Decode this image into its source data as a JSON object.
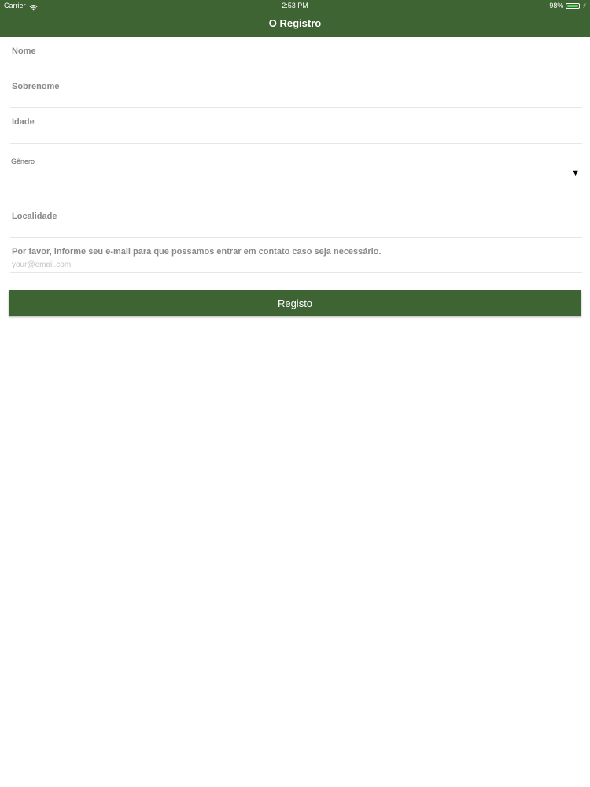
{
  "status_bar": {
    "carrier": "Carrier",
    "time": "2:53 PM",
    "battery_percent": "98%",
    "battery_level": 0.98
  },
  "nav": {
    "title": "O Registro"
  },
  "form": {
    "nome_label": "Nome",
    "sobrenome_label": "Sobrenome",
    "idade_label": "Idade",
    "genero_label": "Gênero",
    "localidade_label": "Localidade",
    "email_prompt": "Por favor, informe seu e-mail para que possamos entrar em contato caso seja necessário.",
    "email_placeholder": "your@email.com",
    "email_value": ""
  },
  "submit": {
    "label": "Registo"
  },
  "colors": {
    "brand_green": "#3f6434",
    "battery_green": "#4cd964"
  }
}
